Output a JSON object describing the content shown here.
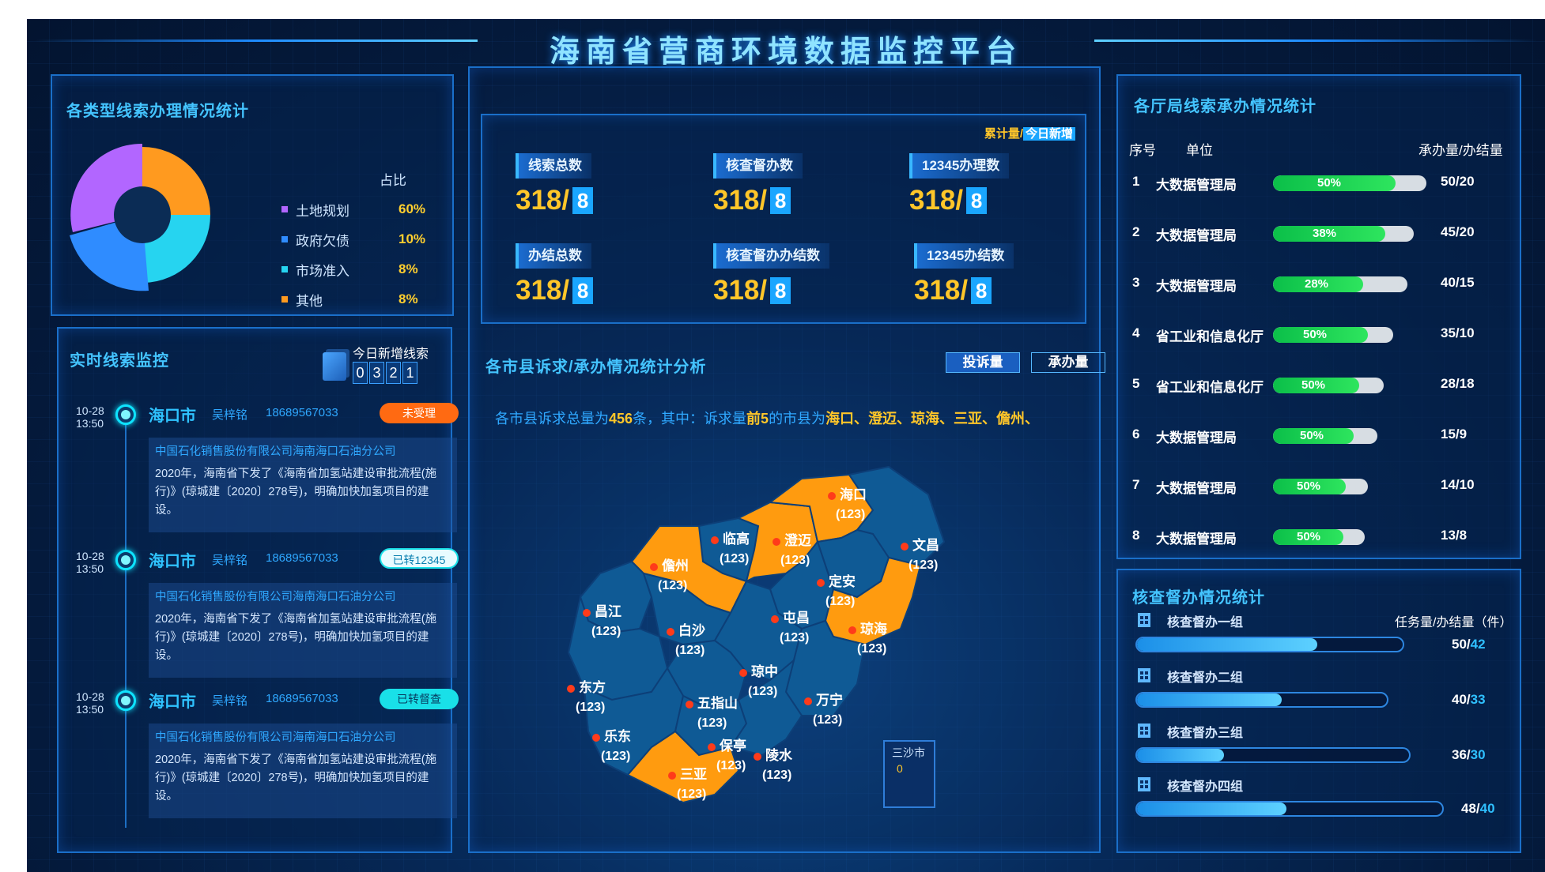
{
  "header": {
    "title": "海南省营商环境数据监控平台"
  },
  "left_top": {
    "title": "各类型线索办理情况统计",
    "share_header": "占比",
    "items": [
      {
        "label": "土地规划",
        "value": "60%",
        "color": "#b266ff"
      },
      {
        "label": "政府欠债",
        "value": "10%",
        "color": "#2f8cff"
      },
      {
        "label": "市场准入",
        "value": "8%",
        "color": "#26d4f0"
      },
      {
        "label": "其他",
        "value": "8%",
        "color": "#ff9a1f"
      }
    ]
  },
  "monitor": {
    "title": "实时线索监控",
    "today_label": "今日新增线索",
    "today_digits": [
      "0",
      "3",
      "2",
      "1"
    ],
    "items": [
      {
        "date": "10-28",
        "time": "13:50",
        "city": "海口市",
        "name": "吴梓铭",
        "phone": "18689567033",
        "badge": "未受理",
        "badge_color": "#ff6a12",
        "company": "中国石化销售股份有限公司海南海口石油分公司",
        "text": "2020年，海南省下发了《海南省加氢站建设审批流程(施行)》(琼城建〔2020〕278号)，明确加快加氢项目的建设。"
      },
      {
        "date": "10-28",
        "time": "13:50",
        "city": "海口市",
        "name": "吴梓铭",
        "phone": "18689567033",
        "badge": "已转12345",
        "badge_color": "#19e0e8",
        "company": "中国石化销售股份有限公司海南海口石油分公司",
        "text": "2020年，海南省下发了《海南省加氢站建设审批流程(施行)》(琼城建〔2020〕278号)，明确加快加氢项目的建设。"
      },
      {
        "date": "10-28",
        "time": "13:50",
        "city": "海口市",
        "name": "吴梓铭",
        "phone": "18689567033",
        "badge": "已转督查",
        "badge_color": "#19e0e8",
        "company": "中国石化销售股份有限公司海南海口石油分公司",
        "text": "2020年，海南省下发了《海南省加氢站建设审批流程(施行)》(琼城建〔2020〕278号)，明确加快加氢项目的建设。"
      }
    ]
  },
  "stats": {
    "legend_cumulative": "累计量/",
    "legend_today": "今日新增",
    "items": [
      {
        "label": "线索总数",
        "value": "318/",
        "new": "8"
      },
      {
        "label": "核查督办数",
        "value": "318/",
        "new": "8"
      },
      {
        "label": "12345办理数",
        "value": "318/",
        "new": "8"
      },
      {
        "label": "办结总数",
        "value": "318/",
        "new": "8"
      },
      {
        "label": "核查督办办结数",
        "value": "318/",
        "new": "8"
      },
      {
        "label": "12345办结数",
        "value": "318/",
        "new": "8"
      }
    ]
  },
  "analysis": {
    "title": "各市县诉求/承办情况统计分析",
    "tab_complaints": "投诉量",
    "tab_handled": "承办量",
    "summary_a": "各市县诉求总量为",
    "summary_total": "456",
    "summary_b": "条，其中：诉求量",
    "summary_top": "前5",
    "summary_c": "的市县为",
    "summary_cities": "海口、澄迈、琼海、三亚、儋州、"
  },
  "map": {
    "cities": [
      {
        "name": "海口",
        "value": "(123)",
        "highlight": true
      },
      {
        "name": "临高",
        "value": "(123)",
        "highlight": false
      },
      {
        "name": "澄迈",
        "value": "(123)",
        "highlight": true
      },
      {
        "name": "文昌",
        "value": "(123)",
        "highlight": false
      },
      {
        "name": "儋州",
        "value": "(123)",
        "highlight": true
      },
      {
        "name": "定安",
        "value": "(123)",
        "highlight": false
      },
      {
        "name": "昌江",
        "value": "(123)",
        "highlight": false
      },
      {
        "name": "白沙",
        "value": "(123)",
        "highlight": false
      },
      {
        "name": "屯昌",
        "value": "(123)",
        "highlight": false
      },
      {
        "name": "琼海",
        "value": "(123)",
        "highlight": true
      },
      {
        "name": "琼中",
        "value": "(123)",
        "highlight": false
      },
      {
        "name": "东方",
        "value": "(123)",
        "highlight": false
      },
      {
        "name": "五指山",
        "value": "(123)",
        "highlight": false
      },
      {
        "name": "万宁",
        "value": "(123)",
        "highlight": false
      },
      {
        "name": "乐东",
        "value": "(123)",
        "highlight": false
      },
      {
        "name": "保亭",
        "value": "(123)",
        "highlight": false
      },
      {
        "name": "陵水",
        "value": "(123)",
        "highlight": false
      },
      {
        "name": "三亚",
        "value": "(123)",
        "highlight": true
      }
    ],
    "sansha_label": "三沙市",
    "sansha_value": "0"
  },
  "departments": {
    "title": "各厅局线索承办情况统计",
    "col_index": "序号",
    "col_unit": "单位",
    "col_ratio": "承办量/办结量",
    "rows": [
      {
        "index": "1",
        "name": "大数据管理局",
        "pct": "50%",
        "progress": 0.8,
        "ratio": "50/20"
      },
      {
        "index": "2",
        "name": "大数据管理局",
        "pct": "38%",
        "progress": 0.8,
        "ratio": "45/20"
      },
      {
        "index": "3",
        "name": "大数据管理局",
        "pct": "28%",
        "progress": 0.67,
        "ratio": "40/15"
      },
      {
        "index": "4",
        "name": "省工业和信息化厅",
        "pct": "50%",
        "progress": 0.79,
        "ratio": "35/10"
      },
      {
        "index": "5",
        "name": "省工业和信息化厅",
        "pct": "50%",
        "progress": 0.78,
        "ratio": "28/18"
      },
      {
        "index": "6",
        "name": "大数据管理局",
        "pct": "50%",
        "progress": 0.77,
        "ratio": "15/9"
      },
      {
        "index": "7",
        "name": "大数据管理局",
        "pct": "50%",
        "progress": 0.77,
        "ratio": "14/10"
      },
      {
        "index": "8",
        "name": "大数据管理局",
        "pct": "50%",
        "progress": 0.77,
        "ratio": "13/8"
      }
    ]
  },
  "supervision": {
    "title": "核查督办情况统计",
    "col_header": "任务量/办结量（件）",
    "groups": [
      {
        "name": "核查督办一组",
        "task": "50",
        "done": "42",
        "progress": 0.68
      },
      {
        "name": "核查督办二组",
        "task": "40",
        "done": "33",
        "progress": 0.58
      },
      {
        "name": "核查督办三组",
        "task": "36",
        "done": "30",
        "progress": 0.32
      },
      {
        "name": "核查督办四组",
        "task": "48",
        "done": "40",
        "progress": 0.49
      }
    ]
  }
}
